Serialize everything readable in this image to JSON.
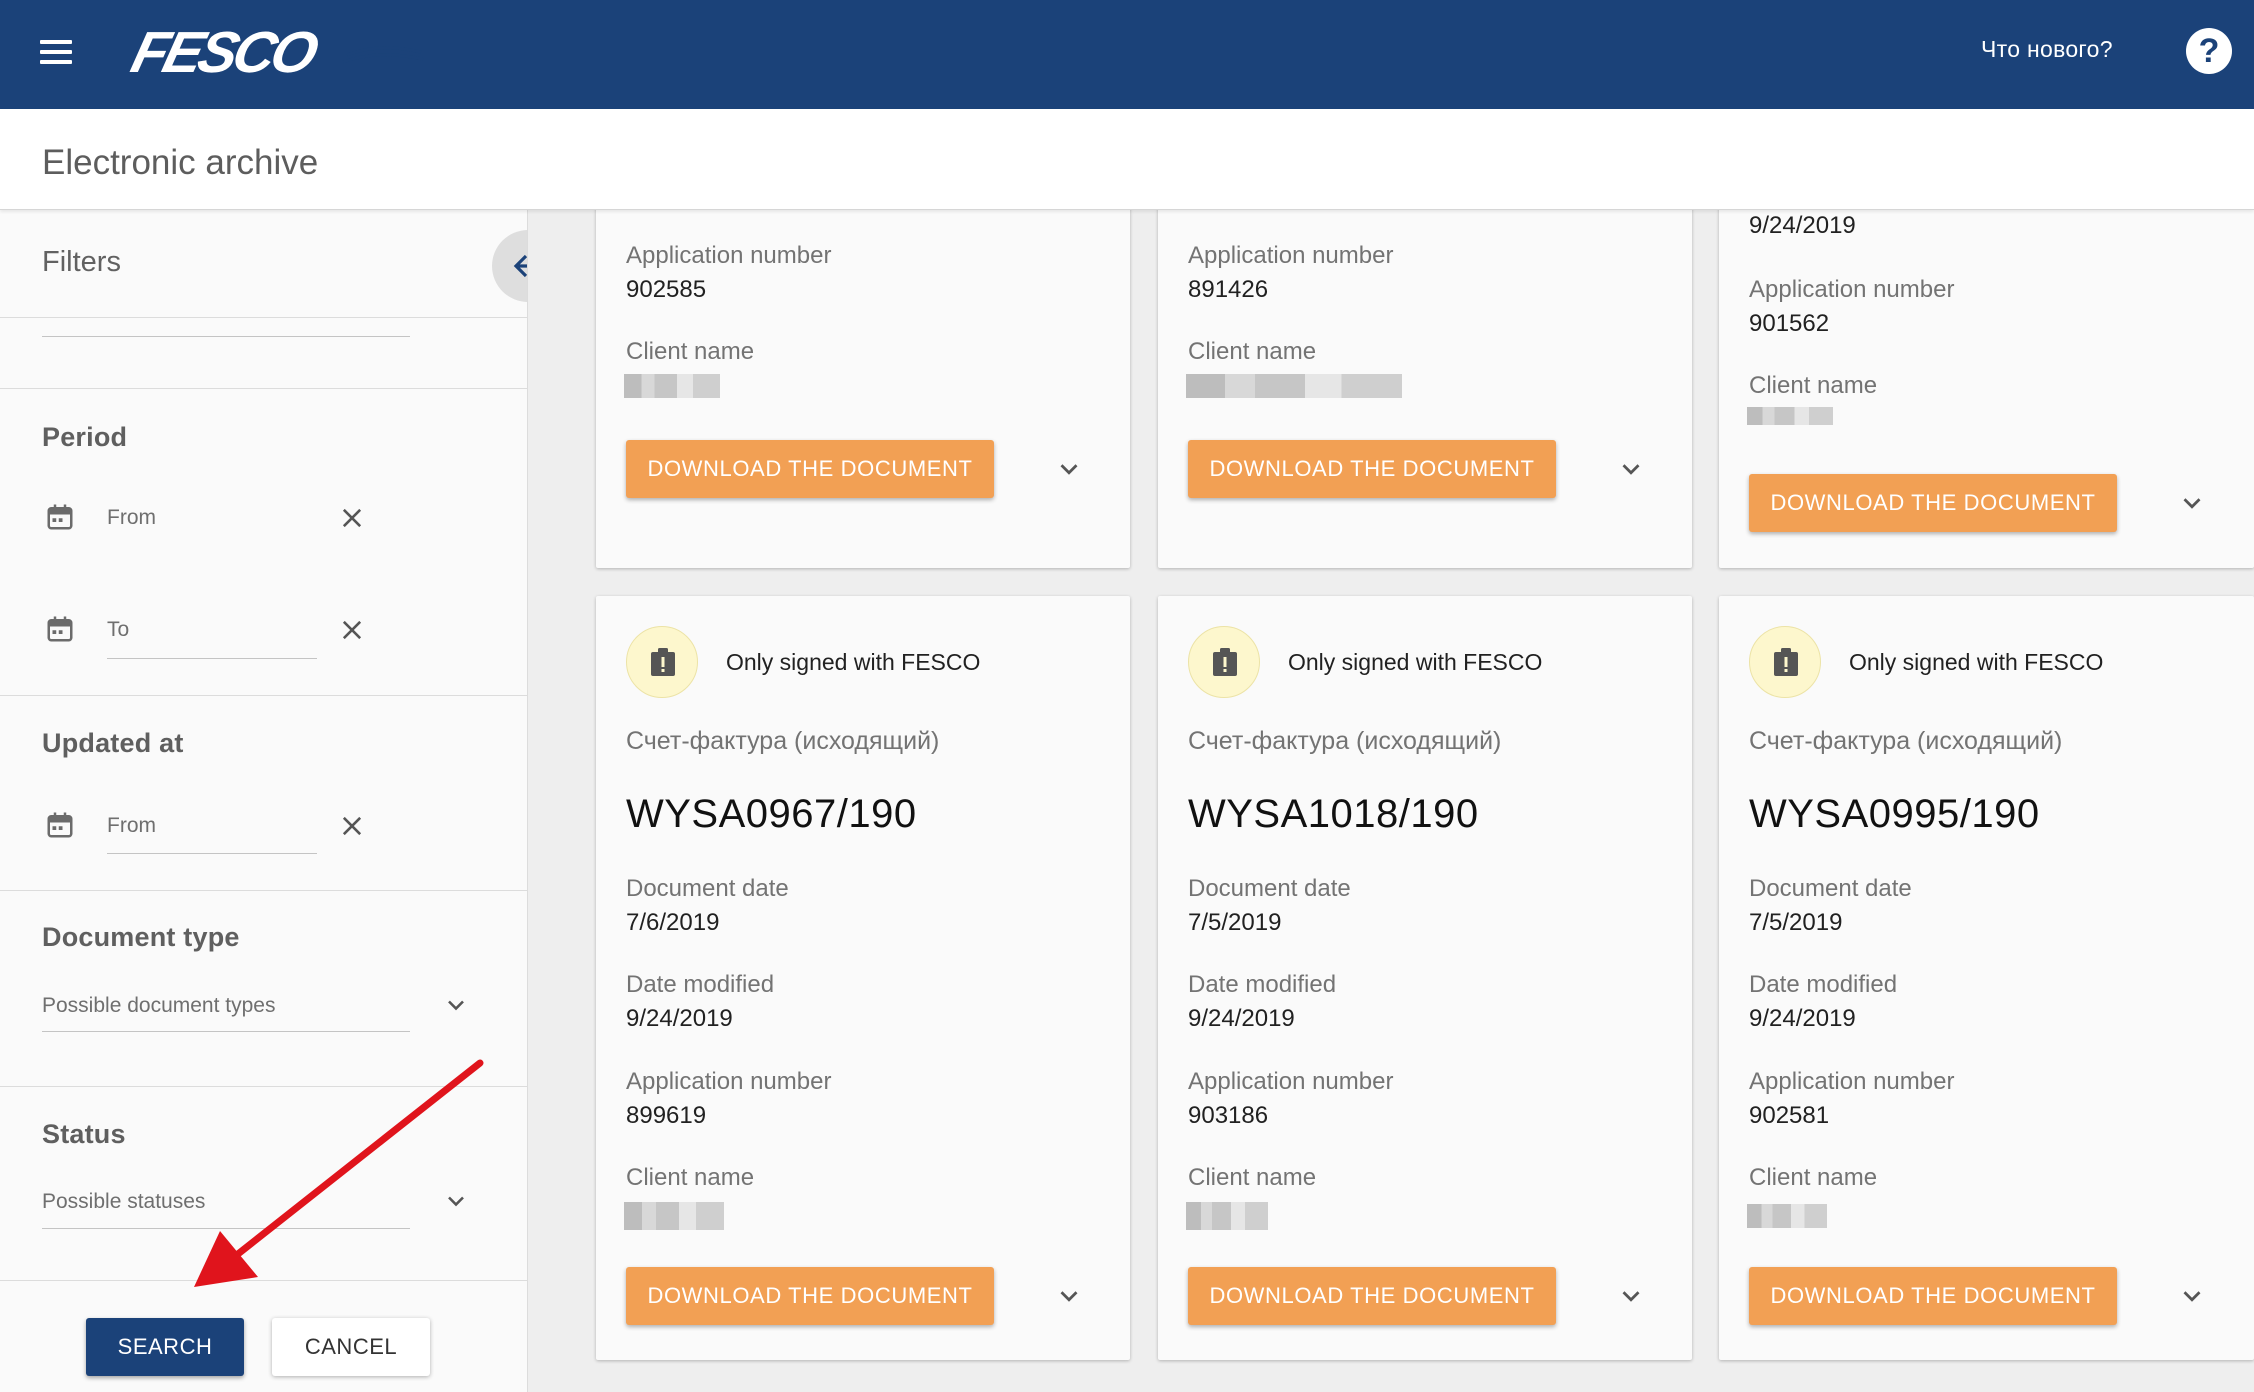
{
  "header": {
    "menu_icon": "hamburger-menu-icon",
    "logo_text": "FESCO",
    "whats_new": "Что нового?",
    "help_icon": "help-icon",
    "help_symbol": "?"
  },
  "page": {
    "title": "Electronic archive"
  },
  "filters": {
    "title": "Filters",
    "collapse_icon": "arrow-left-icon",
    "period": {
      "title": "Period",
      "from_placeholder": "From",
      "to_placeholder": "To"
    },
    "updated_at": {
      "title": "Updated at",
      "from_placeholder": "From"
    },
    "document_type": {
      "title": "Document type",
      "placeholder": "Possible document types"
    },
    "status": {
      "title": "Status",
      "placeholder": "Possible statuses"
    },
    "search_label": "SEARCH",
    "cancel_label": "CANCEL"
  },
  "labels": {
    "application_number": "Application number",
    "client_name": "Client name",
    "document_date": "Document date",
    "date_modified": "Date modified",
    "download": "DOWNLOAD THE DOCUMENT"
  },
  "cards_top": [
    {
      "application_number": "902585"
    },
    {
      "application_number": "891426"
    },
    {
      "date_modified": "9/24/2019",
      "application_number": "901562"
    }
  ],
  "cards": [
    {
      "signature_status": "Only signed with FESCO",
      "document_type": "Счет-фактура (исходящий)",
      "document_number": "WYSA0967/190",
      "document_date": "7/6/2019",
      "date_modified": "9/24/2019",
      "application_number": "899619"
    },
    {
      "signature_status": "Only signed with FESCO",
      "document_type": "Счет-фактура (исходящий)",
      "document_number": "WYSA1018/190",
      "document_date": "7/5/2019",
      "date_modified": "9/24/2019",
      "application_number": "903186"
    },
    {
      "signature_status": "Only signed with FESCO",
      "document_type": "Счет-фактура (исходящий)",
      "document_number": "WYSA0995/190",
      "document_date": "7/5/2019",
      "date_modified": "9/24/2019",
      "application_number": "902581"
    }
  ],
  "colors": {
    "header_bg": "#1b4279",
    "download_button": "#f2a054",
    "search_button": "#1b4279",
    "annotation_arrow": "#e0141c"
  }
}
